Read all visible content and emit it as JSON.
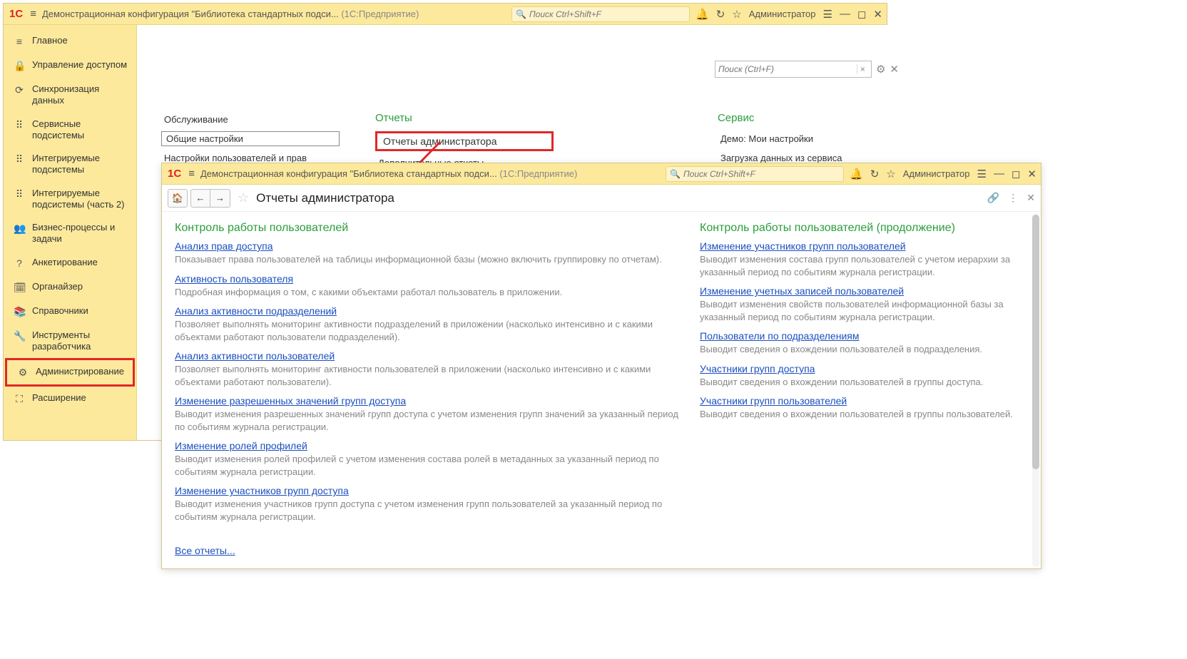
{
  "window1": {
    "title_main": "Демонстрационная конфигурация \"Библиотека стандартных подси...",
    "title_paren": "(1С:Предприятие)",
    "search_placeholder": "Поиск Ctrl+Shift+F",
    "user": "Администратор"
  },
  "sidebar": {
    "items": [
      {
        "icon": "≡",
        "label": "Главное"
      },
      {
        "icon": "🔒",
        "label": "Управление доступом"
      },
      {
        "icon": "⟳",
        "label": "Синхронизация данных"
      },
      {
        "icon": "⠿",
        "label": "Сервисные подсистемы"
      },
      {
        "icon": "⠿",
        "label": "Интегрируемые подсистемы"
      },
      {
        "icon": "⠿",
        "label": "Интегрируемые подсистемы (часть 2)"
      },
      {
        "icon": "👥",
        "label": "Бизнес-процессы и задачи"
      },
      {
        "icon": "?",
        "label": "Анкетирование"
      },
      {
        "icon": "🗓",
        "label": "Органайзер"
      },
      {
        "icon": "📚",
        "label": "Справочники"
      },
      {
        "icon": "🔧",
        "label": "Инструменты разработчика"
      },
      {
        "icon": "⚙",
        "label": "Администрирование"
      },
      {
        "icon": "⛶",
        "label": "Расширение"
      }
    ]
  },
  "w1main": {
    "search_placeholder": "Поиск (Ctrl+F)",
    "col1": {
      "items": [
        "Обслуживание",
        "Общие настройки",
        "Настройки пользователей и прав"
      ]
    },
    "col2": {
      "header": "Отчеты",
      "item_reports": "Отчеты администратора",
      "item_additional": "Дополнительные отчеты"
    },
    "col3": {
      "header": "Сервис",
      "items": [
        "Демо: Мои настройки",
        "Загрузка данных из сервиса"
      ]
    }
  },
  "window2": {
    "title_main": "Демонстрационная конфигурация \"Библиотека стандартных подси...",
    "title_paren": "(1С:Предприятие)",
    "search_placeholder": "Поиск Ctrl+Shift+F",
    "user": "Администратор",
    "page_title": "Отчеты администратора"
  },
  "reports_left": {
    "section": "Контроль работы пользователей",
    "items": [
      {
        "title": "Анализ прав доступа",
        "desc": "Показывает права пользователей на таблицы информационной базы (можно включить группировку по отчетам)."
      },
      {
        "title": "Активность пользователя",
        "desc": "Подробная информация о том, с какими объектами работал пользователь в приложении."
      },
      {
        "title": "Анализ активности подразделений",
        "desc": "Позволяет выполнять мониторинг активности подразделений в приложении (насколько интенсивно и с какими объектами работают пользователи подразделений)."
      },
      {
        "title": "Анализ активности пользователей",
        "desc": "Позволяет выполнять мониторинг активности пользователей в приложении (насколько интенсивно и с какими объектами работают пользователи)."
      },
      {
        "title": "Изменение разрешенных значений групп доступа",
        "desc": "Выводит изменения разрешенных значений групп доступа с учетом изменения групп значений за указанный период по событиям журнала регистрации."
      },
      {
        "title": "Изменение ролей профилей",
        "desc": "Выводит изменения ролей профилей с учетом изменения состава ролей в метаданных за указанный период по событиям журнала регистрации."
      },
      {
        "title": "Изменение участников групп доступа",
        "desc": "Выводит изменения участников групп доступа с учетом изменения групп пользователей за указанный период по событиям журнала регистрации."
      }
    ],
    "all_reports": "Все отчеты..."
  },
  "reports_right": {
    "section": "Контроль работы пользователей (продолжение)",
    "items": [
      {
        "title": "Изменение участников групп пользователей",
        "desc": "Выводит изменения состава групп пользователей с учетом иерархии за указанный период по событиям журнала регистрации."
      },
      {
        "title": "Изменение учетных записей пользователей",
        "desc": "Выводит изменения свойств пользователей информационной базы за указанный период по событиям журнала регистрации."
      },
      {
        "title": "Пользователи по подразделениям",
        "desc": "Выводит сведения о вхождении пользователей в подразделения."
      },
      {
        "title": "Участники групп доступа",
        "desc": "Выводит сведения о вхождении пользователей в группы доступа."
      },
      {
        "title": "Участники групп пользователей",
        "desc": "Выводит сведения о вхождении пользователей в группы пользователей."
      }
    ]
  }
}
